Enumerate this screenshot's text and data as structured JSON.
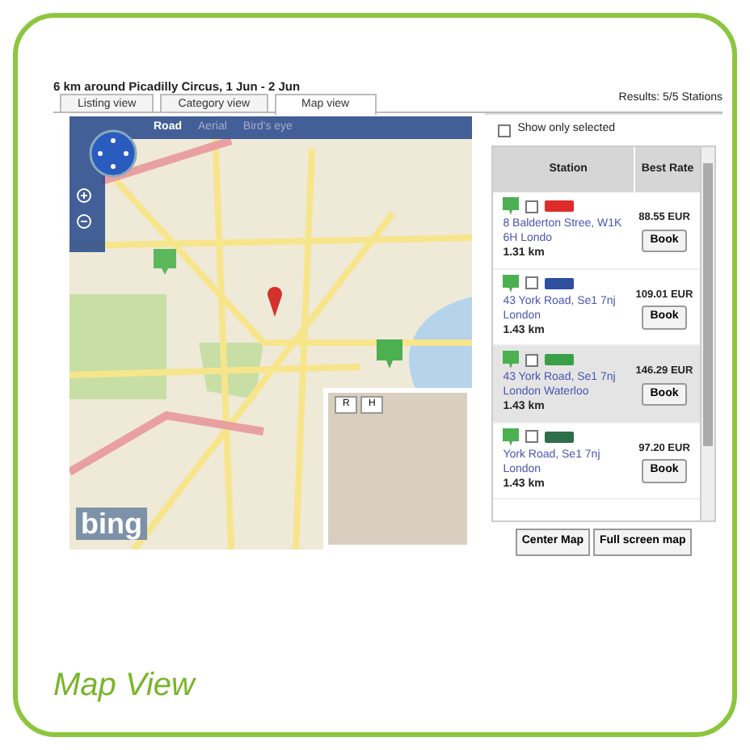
{
  "title": "6 km around Picadilly Circus, 1 Jun - 2 Jun",
  "results": "Results: 5/5 Stations",
  "tabs": [
    {
      "label": "Listing view",
      "selected": false
    },
    {
      "label": "Category view",
      "selected": false
    },
    {
      "label": "Map view",
      "selected": true
    }
  ],
  "map": {
    "map_types": [
      {
        "label": "Road",
        "selected": true
      },
      {
        "label": "Aerial",
        "selected": false
      },
      {
        "label": "Bird's eye",
        "selected": false
      }
    ],
    "overview_buttons": [
      "R",
      "H"
    ],
    "logo": "bing"
  },
  "show_only_selected": {
    "label": "Show only selected",
    "checked": false
  },
  "columns": [
    "Station",
    "Best Rate"
  ],
  "stations": [
    {
      "address": "8 Balderton Stree, W1K 6H Londo",
      "distance": "1.31 km",
      "price": "88.55 EUR",
      "button": "Book",
      "checked": false,
      "selected": false,
      "color": "#e02b2b"
    },
    {
      "address": "43 York Road, Se1 7nj London",
      "distance": "1.43 km",
      "price": "109.01 EUR",
      "button": "Book",
      "checked": false,
      "selected": false,
      "color": "#2d4f9e"
    },
    {
      "address": "43 York Road, Se1 7nj London Waterloo",
      "distance": "1.43 km",
      "price": "146.29 EUR",
      "button": "Book",
      "checked": false,
      "selected": true,
      "color": "#3aa047"
    },
    {
      "address": "York Road, Se1 7nj London",
      "distance": "1.43 km",
      "price": "97.20 EUR",
      "button": "Book",
      "checked": false,
      "selected": false,
      "color": "#2e6e4a"
    }
  ],
  "buttons": [
    "Center Map",
    "Full screen map"
  ],
  "caption": "Map View"
}
